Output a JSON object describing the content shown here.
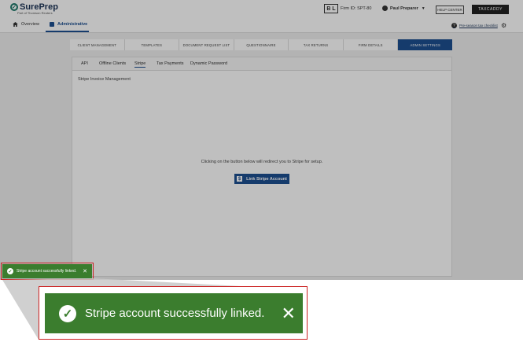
{
  "header": {
    "brand": "SurePrep",
    "brand_sub": "Part of Thomson Reuters",
    "firm_badge": "B L",
    "firm_id": "Firm ID: SPT-80",
    "user_name": "Paul Preparer",
    "help_label": "HELP CENTER",
    "taxcaddy_label": "TAXCADDY"
  },
  "nav": {
    "overview": "Overview",
    "administrative": "Administrative",
    "checklist": "Pre-season tax checklist"
  },
  "top_tabs": [
    {
      "label": "CLIENT MANAGEMENT"
    },
    {
      "label": "TEMPLATES"
    },
    {
      "label": "DOCUMENT REQUEST LIST"
    },
    {
      "label": "QUESTIONNAIRE"
    },
    {
      "label": "TAX RETURNS"
    },
    {
      "label": "FIRM DETAILS"
    },
    {
      "label": "ADMIN SETTINGS"
    }
  ],
  "sub_tabs": [
    {
      "label": "API"
    },
    {
      "label": "Offline Clients"
    },
    {
      "label": "Stripe"
    },
    {
      "label": "Tax Payments"
    },
    {
      "label": "Dynamic Password"
    }
  ],
  "content": {
    "section_title": "Stripe Invoice Management",
    "redirect_text": "Clicking on the button below will redirect you to Stripe for setup.",
    "link_button": "Link Stripe Account"
  },
  "toast": {
    "message": "Stripe account successfully linked."
  },
  "colors": {
    "primary": "#1d4f91",
    "success": "#3b7d2e",
    "highlight": "#cc2222"
  }
}
